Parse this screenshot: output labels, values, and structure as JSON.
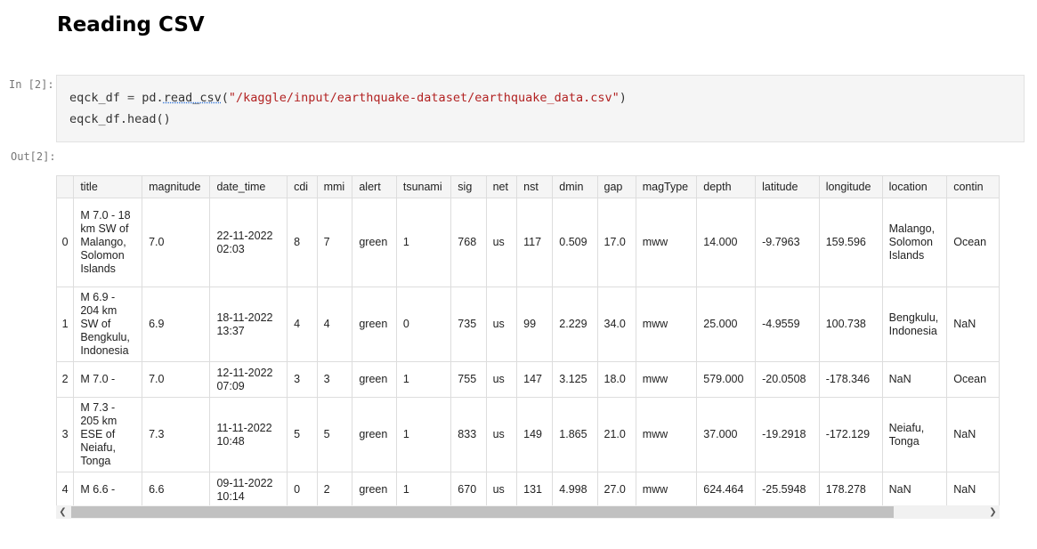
{
  "heading": "Reading CSV",
  "input_prompt": "In [2]:",
  "output_prompt": "Out[2]:",
  "code": {
    "line1": {
      "var": "eqck_df",
      "assign": " = ",
      "module": "pd.",
      "func": "read_csv",
      "open": "(",
      "path": "\"/kaggle/input/earthquake-dataset/earthquake_data.csv\"",
      "close": ")"
    },
    "line2": "eqck_df.head()"
  },
  "table": {
    "columns": [
      "",
      "title",
      "magnitude",
      "date_time",
      "cdi",
      "mmi",
      "alert",
      "tsunami",
      "sig",
      "net",
      "nst",
      "dmin",
      "gap",
      "magType",
      "depth",
      "latitude",
      "longitude",
      "location",
      "contin"
    ],
    "rows": [
      {
        "index": "0",
        "cells": [
          "M 7.0 - 18 km SW of Malango, Solomon Islands",
          "7.0",
          "22-11-2022 02:03",
          "8",
          "7",
          "green",
          "1",
          "768",
          "us",
          "117",
          "0.509",
          "17.0",
          "mww",
          "14.000",
          "-9.7963",
          "159.596",
          "Malango, Solomon Islands",
          "Ocean"
        ]
      },
      {
        "index": "1",
        "cells": [
          "M 6.9 - 204 km SW of Bengkulu, Indonesia",
          "6.9",
          "18-11-2022 13:37",
          "4",
          "4",
          "green",
          "0",
          "735",
          "us",
          "99",
          "2.229",
          "34.0",
          "mww",
          "25.000",
          "-4.9559",
          "100.738",
          "Bengkulu, Indonesia",
          "NaN"
        ]
      },
      {
        "index": "2",
        "cells": [
          "M 7.0 -",
          "7.0",
          "12-11-2022 07:09",
          "3",
          "3",
          "green",
          "1",
          "755",
          "us",
          "147",
          "3.125",
          "18.0",
          "mww",
          "579.000",
          "-20.0508",
          "-178.346",
          "NaN",
          "Ocean"
        ]
      },
      {
        "index": "3",
        "cells": [
          "M 7.3 - 205 km ESE of Neiafu, Tonga",
          "7.3",
          "11-11-2022 10:48",
          "5",
          "5",
          "green",
          "1",
          "833",
          "us",
          "149",
          "1.865",
          "21.0",
          "mww",
          "37.000",
          "-19.2918",
          "-172.129",
          "Neiafu, Tonga",
          "NaN"
        ]
      },
      {
        "index": "4",
        "cells": [
          "M 6.6 -",
          "6.6",
          "09-11-2022 10:14",
          "0",
          "2",
          "green",
          "1",
          "670",
          "us",
          "131",
          "4.998",
          "27.0",
          "mww",
          "624.464",
          "-25.5948",
          "178.278",
          "NaN",
          "NaN"
        ]
      }
    ]
  },
  "scrollbar": {
    "left_arrow_icon": "chevron-left-icon",
    "right_arrow_icon": "chevron-right-icon",
    "left_arrow_glyph": "❮",
    "right_arrow_glyph": "❯"
  }
}
